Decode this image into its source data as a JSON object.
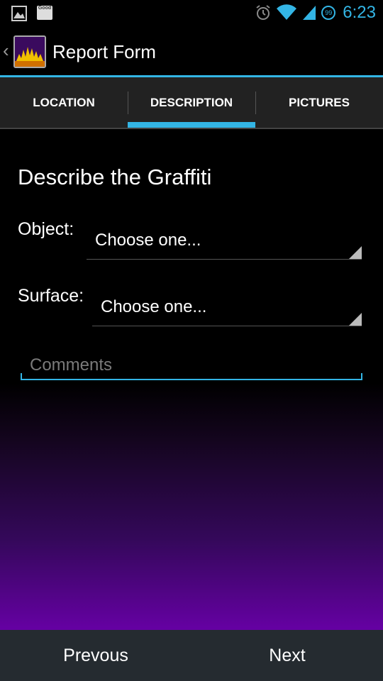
{
  "status_bar": {
    "notification_icons": [
      "image-icon",
      "good-app-icon"
    ],
    "good_label": "Good",
    "battery_level": "99",
    "time": "6:23",
    "icons": [
      "alarm-icon",
      "wifi-icon",
      "signal-icon",
      "battery-icon"
    ]
  },
  "action_bar": {
    "title": "Report Form"
  },
  "tabs": [
    {
      "label": "LOCATION",
      "active": false
    },
    {
      "label": "DESCRIPTION",
      "active": true
    },
    {
      "label": "PICTURES",
      "active": false
    }
  ],
  "form": {
    "heading": "Describe the Graffiti",
    "object_label": "Object:",
    "object_value": "Choose one...",
    "surface_label": "Surface:",
    "surface_value": "Choose one...",
    "comments_placeholder": "Comments",
    "comments_value": ""
  },
  "footer": {
    "previous_label": "Prevous",
    "next_label": "Next"
  },
  "colors": {
    "accent": "#33b5e5",
    "gradient_end": "#6a00aa",
    "footer_bg": "#252b30",
    "tab_bg": "#222222"
  }
}
